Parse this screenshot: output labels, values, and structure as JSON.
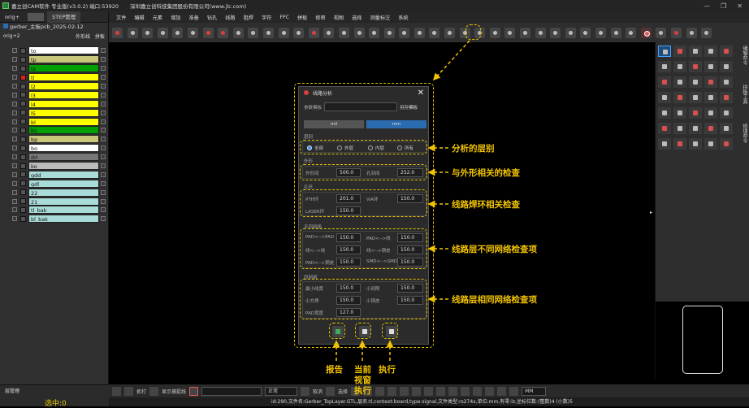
{
  "window": {
    "app_title": "嘉立创CAM软件 专业版(v3.0.2) 端口:53920",
    "company": "深圳嘉立创科技集团股份有限公司(www.jlc.com)",
    "buttons": [
      "—",
      "❐",
      "✕"
    ]
  },
  "left_panel": {
    "tab1": "orig+",
    "tab2": "STEP管理",
    "project": "gerber_主板pcb_2025-02-12",
    "step": "orig+2",
    "header_outline": "外形线",
    "header_flip": "拼板",
    "layers": [
      {
        "name": "to",
        "color": "#ffffff",
        "swatch": "#555555"
      },
      {
        "name": "tp",
        "color": "#c9c77a",
        "swatch": "#555555"
      },
      {
        "name": "ts",
        "color": "#00a000",
        "swatch": "#555555"
      },
      {
        "name": "tl",
        "color": "#ffff00",
        "swatch": "#e02020"
      },
      {
        "name": "l2",
        "color": "#ffff00",
        "swatch": "#555555"
      },
      {
        "name": "l3",
        "color": "#ffff00",
        "swatch": "#555555"
      },
      {
        "name": "l4",
        "color": "#ffff00",
        "swatch": "#555555"
      },
      {
        "name": "l5",
        "color": "#ffff00",
        "swatch": "#555555"
      },
      {
        "name": "bl",
        "color": "#ffff00",
        "swatch": "#555555"
      },
      {
        "name": "bs",
        "color": "#00a000",
        "swatch": "#555555"
      },
      {
        "name": "bp",
        "color": "#c9c77a",
        "swatch": "#555555"
      },
      {
        "name": "bo",
        "color": "#ffffff",
        "swatch": "#555555"
      },
      {
        "name": "drl",
        "color": "#777777",
        "swatch": "#555555"
      },
      {
        "name": "ko",
        "color": "#bbbbbb",
        "swatch": "#555555"
      },
      {
        "name": "gdd",
        "color": "#a9dcd8",
        "swatch": "#555555"
      },
      {
        "name": "gdl",
        "color": "#a9dcd8",
        "swatch": "#555555"
      },
      {
        "name": "22",
        "color": "#a9dcd8",
        "swatch": "#555555"
      },
      {
        "name": "21",
        "color": "#a9dcd8",
        "swatch": "#555555"
      },
      {
        "name": "tl_bak",
        "color": "#a9dcd8",
        "swatch": "#555555"
      },
      {
        "name": "bl_bak",
        "color": "#a9dcd8",
        "swatch": "#555555"
      }
    ],
    "layer_manager": "层管理",
    "selected": "选中:0"
  },
  "menu": [
    "文件",
    "编辑",
    "元素",
    "增加",
    "准备",
    "钻孔",
    "线路",
    "阻焊",
    "字符",
    "FPC",
    "拼板",
    "修审",
    "视图",
    "选择",
    "测量标注",
    "系统"
  ],
  "right_panel": {
    "tabs": [
      "编辑命令",
      "拼板工具",
      "修理命令"
    ]
  },
  "dialog": {
    "title": "线路分析",
    "template_label": "参数模板",
    "save_template": "另存模板",
    "unit_mil": "mil",
    "unit_mm": "mm",
    "layer_section": "层别",
    "layer_options": [
      "全部",
      "外层",
      "内层",
      "所有"
    ],
    "outline_section": "外形",
    "outline_label1": "外形间",
    "outline_value1": "500.0",
    "outline_label2": "孔到间",
    "outline_value2": "252.0",
    "ring_section": "孔环",
    "pth_label": "PTH环",
    "pth_value": "201.0",
    "via_label": "VIA环",
    "via_value": "150.0",
    "laser_label": "LASER环",
    "laser_value": "150.0",
    "diff_section": "不同网络",
    "diff_items": [
      {
        "label": "PAD<-->PAD",
        "value": "150.0"
      },
      {
        "label": "PAD<-->线",
        "value": "150.0"
      },
      {
        "label": "线<-->线",
        "value": "150.0"
      },
      {
        "label": "线<-->铜皮",
        "value": "150.0"
      },
      {
        "label": "PAD<-->铜皮",
        "value": "150.0"
      },
      {
        "label": "SMD<-->SMD",
        "value": "150.0"
      }
    ],
    "same_section": "同网络",
    "same_items": [
      {
        "label": "最小线宽",
        "value": "150.0"
      },
      {
        "label": "小间隙",
        "value": "150.0"
      },
      {
        "label": "小方焊",
        "value": "150.0"
      },
      {
        "label": "小铜皮",
        "value": "150.0"
      },
      {
        "label": "PAD宽度",
        "value": "127.0"
      }
    ]
  },
  "annotations": {
    "layer": "分析的层别",
    "outline": "与外形相关的检查",
    "ring": "线路焊环相关检查",
    "diff": "线路层不同网络检查项",
    "same": "线路层相同网络检查项",
    "report": "报告",
    "current_view_1": "当前",
    "current_view_2": "视窗",
    "current_view_3": "执行",
    "execute": "执行"
  },
  "bottombar": {
    "mode": "抓打",
    "show_label": "显示捕捉线",
    "field2": "正常",
    "btn_a": "取消",
    "btn_b": "选择",
    "unit": "MM"
  },
  "status": "id:290,文件名:Gerber_TopLayer.GTL,层名:tl,context:board,type:signal,文件类型:rs274x,单位:mm,有零:lz,坐标位数:(整数)4 (小数)5",
  "colors": {
    "accent": "#e6c200",
    "primary_btn": "#2b6cb0"
  }
}
